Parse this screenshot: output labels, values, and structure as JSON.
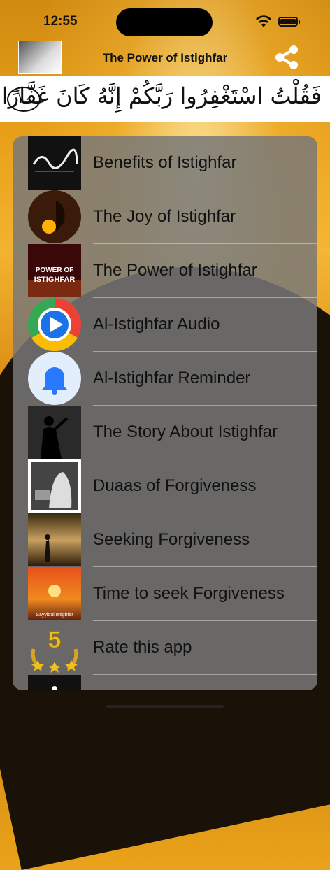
{
  "status": {
    "time": "12:55"
  },
  "nav": {
    "title": "The Power of Istighfar",
    "share_icon": "share-icon"
  },
  "banner": {
    "verse": "فَقُلْتُ اسْتَغْفِرُوا رَبَّكُمْ إِنَّهُ كَانَ غَفَّارًا",
    "ayah_number": "١٠"
  },
  "menu": [
    {
      "label": "Benefits of Istighfar",
      "thumb": "calligraphy"
    },
    {
      "label": "The Joy of Istighfar",
      "thumb": "joy"
    },
    {
      "label": "The Power of Istighfar",
      "thumb": "power",
      "thumb_text": "POWER OF ISTIGHFAR"
    },
    {
      "label": "Al-Istighfar Audio",
      "thumb": "play-icon"
    },
    {
      "label": "Al-Istighfar Reminder",
      "thumb": "bell-icon"
    },
    {
      "label": "The Story About Istighfar",
      "thumb": "story"
    },
    {
      "label": "Duaas of Forgiveness",
      "thumb": "duaas"
    },
    {
      "label": "Seeking Forgiveness",
      "thumb": "seeking"
    },
    {
      "label": "Time to seek Forgiveness",
      "thumb": "sunset",
      "thumb_text": "Sayyidul Istighfar"
    },
    {
      "label": "Rate this app",
      "thumb": "star-icon",
      "thumb_text": "5"
    }
  ]
}
